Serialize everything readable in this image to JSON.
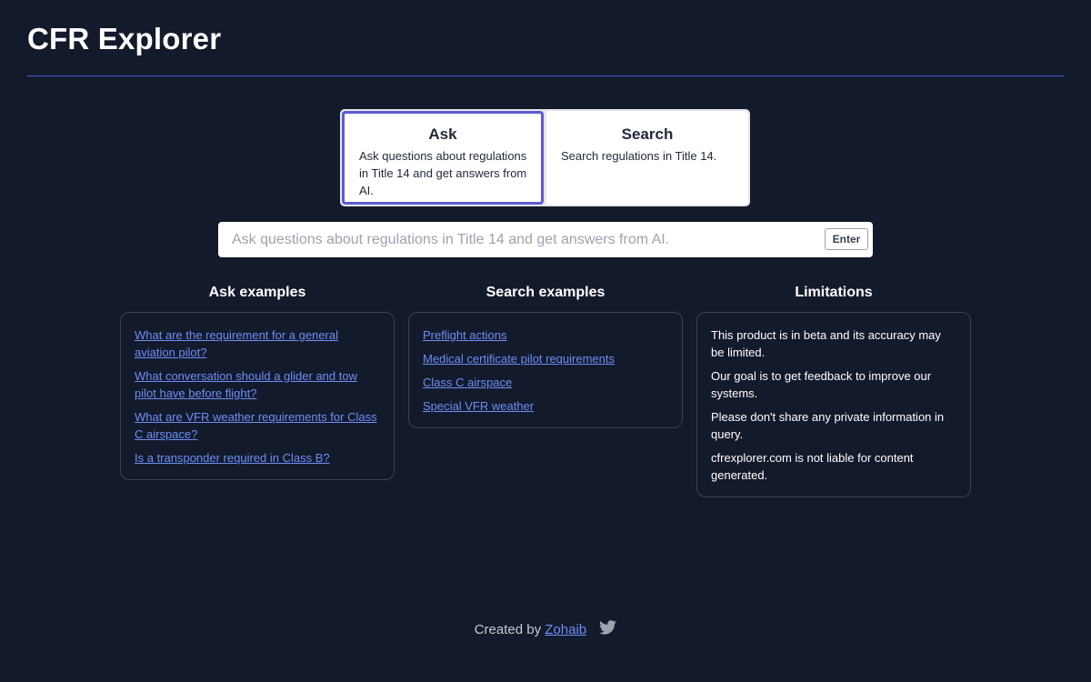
{
  "header": {
    "title": "CFR Explorer"
  },
  "modes": {
    "ask": {
      "title": "Ask",
      "description": "Ask questions about regulations in Title 14 and get answers from AI."
    },
    "search": {
      "title": "Search",
      "description": "Search regulations in Title 14."
    }
  },
  "query": {
    "placeholder": "Ask questions about regulations in Title 14 and get answers from AI.",
    "enter_label": "Enter"
  },
  "ask_examples": {
    "title": "Ask examples",
    "items": [
      "What are the requirement for a general aviation pilot?",
      "What conversation should a glider and tow pilot have before flight?",
      "What are VFR weather requirements for Class C airspace?",
      "Is a transponder required in Class B?"
    ]
  },
  "search_examples": {
    "title": "Search examples",
    "items": [
      "Preflight actions",
      "Medical certificate pilot requirements",
      "Class C airspace",
      "Special VFR weather"
    ]
  },
  "limitations": {
    "title": "Limitations",
    "items": [
      "This product is in beta and its accuracy may be limited.",
      "Our goal is to get feedback to improve our systems.",
      "Please don't share any private information in query.",
      "cfrexplorer.com is not liable for content generated."
    ]
  },
  "footer": {
    "prefix": "Created by",
    "author": "Zohaib",
    "social_icon": "twitter-icon"
  },
  "colors": {
    "background": "#131a2b",
    "accent": "#5b5bd6",
    "link": "#6e8ef7"
  }
}
